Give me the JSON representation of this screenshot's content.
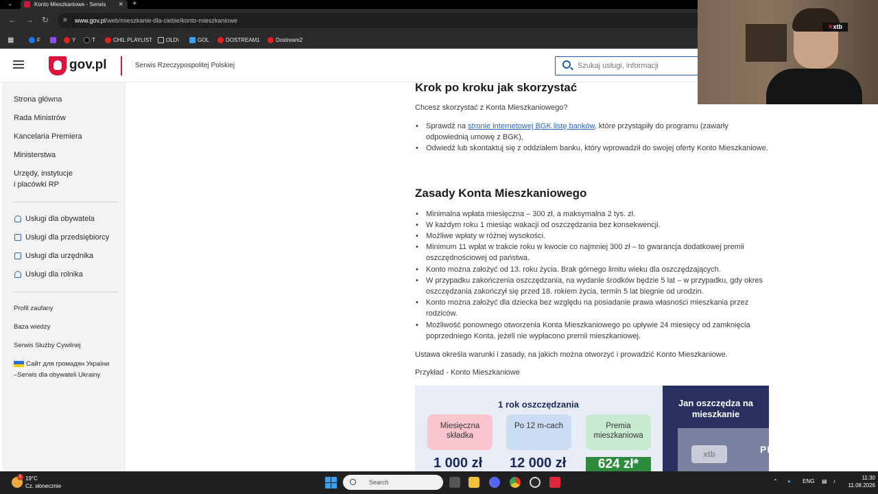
{
  "browser": {
    "tab_title": "Konto Mieszkaniowe - Serwis",
    "url_host": "www.gov.pl",
    "url_path": "/web/mieszkanie-dla-ciebie/konto-mieszkaniowe",
    "bookmarks": [
      "F",
      "Y",
      "T",
      "CHIL PLAYLIST",
      "OLD\\",
      "GOL",
      "DOSTREAM1",
      "Dostream2"
    ]
  },
  "header": {
    "logo_text": "gov.pl",
    "site_name": "Serwis Rzeczypospolitej Polskiej",
    "search_placeholder": "Szukaj usługi, informacji"
  },
  "sidebar": {
    "main_items": [
      "Strona główna",
      "Rada Ministrów",
      "Kancelaria Premiera",
      "Ministerstwa",
      "Urzędy, instytucje",
      "i placówki RP"
    ],
    "service_items": [
      "Usługi dla obywatela",
      "Usługi dla przedsiębiorcy",
      "Usługi dla urzędnika",
      "Usługi dla rolnika"
    ],
    "extra_items": [
      "Profil zaufany",
      "Baza wiedzy",
      "Serwis Służby Cywilnej",
      "Сайт для громадян України",
      "–Serwis dla obywateli Ukrainy"
    ]
  },
  "content": {
    "section1_title": "Krok po kroku jak skorzystać",
    "section1_intro": "Chcesz skorzystać z Konta Mieszkaniowego?",
    "section1_li1_pre": "Sprawdź na ",
    "section1_li1_link": "stronie internetowej BGK listę banków",
    "section1_li1_post": ", które przystąpiły do programu (zawarły odpowiednią umowę z BGK),",
    "section1_li2": "Odwiedź lub skontaktuj się z oddziałem banku, który wprowadził do swojej oferty Konto Mieszkaniowe.",
    "section2_title": "Zasady Konta Mieszkaniowego",
    "rules": [
      "Minimalna wpłata miesięczna – 300 zł, a maksymalna 2 tys. zł.",
      "W każdym roku 1 miesiąc wakacji od oszczędzania bez konsekwencji.",
      "Możliwe wpłaty w różnej wysokości.",
      "Minimum 11 wpłat w trakcie roku w kwocie co najmniej 300 zł – to gwarancja dodatkowej premii oszczędnościowej od państwa.",
      "Konto można założyć od 13. roku życia. Brak górnego limitu wieku dla oszczędzających.",
      "W przypadku zakończenia oszczędzania, na wydanie środków będzie 5 lat – w przypadku, gdy okres oszczędzania zakończył się przed 18. rokiem życia, termin 5 lat biegnie od urodzin.",
      "Konto można założyć dla dziecka bez względu na posiadanie prawa własności mieszkania przez rodziców.",
      "Możliwość ponownego otworzenia Konta Mieszkaniowego po upływie 24 miesięcy od zamknięcia poprzedniego Konta, jeżeli nie wypłacono premii mieszkaniowej."
    ],
    "statute_text": "Ustawa określa warunki i zasady, na jakich można otworzyć i prowadzić Konto Mieszkaniowe.",
    "example_label": "Przykład - Konto Mieszkaniowe"
  },
  "infographic": {
    "title": "1 rok oszczędzania",
    "box1": "Miesięczna składka",
    "box2": "Po 12 m-cach",
    "box3": "Premia mieszkaniowa",
    "val1": "1 000 zł",
    "val2": "12 000 zł",
    "val3": "624 zł*",
    "right_title": "Jan oszczędza na mieszkanie",
    "ad_xtb": "xtb",
    "ad_text": "PIRATE SWAP",
    "colors": {
      "box1": "#f9c6cf",
      "box2": "#c9dcf2",
      "box3": "#c8ebd0"
    }
  },
  "webcam": {
    "badge": "xtb"
  },
  "taskbar": {
    "weather_temp": "19°C",
    "weather_desc": "Cz. słonecznie",
    "weather_badge": "1",
    "search_label": "Search",
    "lang": "ENG",
    "time": "11:30",
    "date": "11.08.2026"
  }
}
